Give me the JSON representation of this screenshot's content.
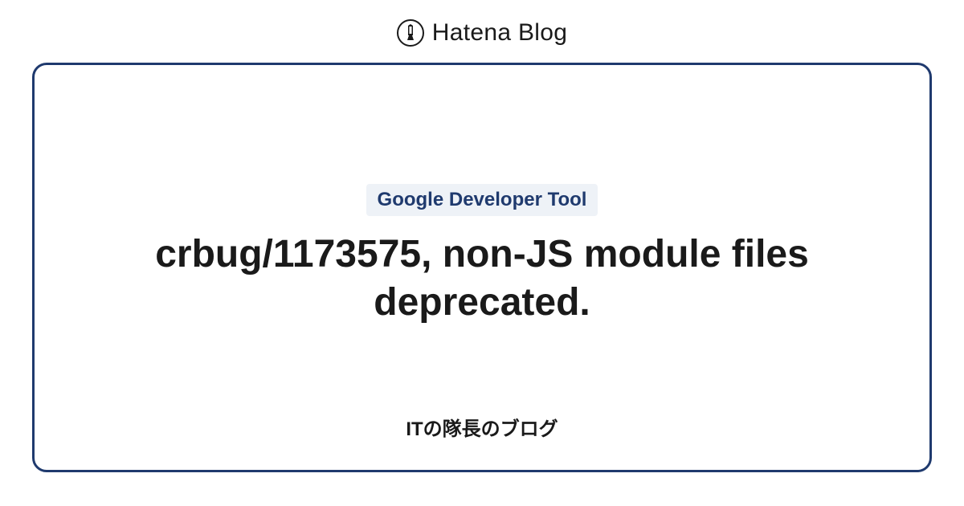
{
  "header": {
    "brand": "Hatena Blog"
  },
  "card": {
    "tag": "Google Developer Tool",
    "title": "crbug/1173575, non-JS module files deprecated.",
    "blog_name": "ITの隊長のブログ"
  }
}
